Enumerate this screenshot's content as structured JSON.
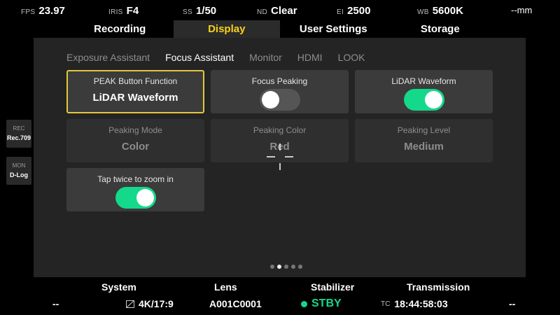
{
  "status_top": {
    "fps": {
      "key": "FPS",
      "value": "23.97"
    },
    "iris": {
      "key": "IRIS",
      "value": "F4"
    },
    "ss": {
      "key": "SS",
      "value": "1/50"
    },
    "nd": {
      "key": "ND",
      "value": "Clear"
    },
    "ei": {
      "key": "EI",
      "value": "2500"
    },
    "wb": {
      "key": "WB",
      "value": "5600K"
    },
    "focus_distance": "--mm"
  },
  "main_tabs": [
    "Recording",
    "Display",
    "User Settings",
    "Storage"
  ],
  "active_main_tab": "Display",
  "sub_tabs": [
    "Exposure Assistant",
    "Focus Assistant",
    "Monitor",
    "HDMI",
    "LOOK"
  ],
  "active_sub_tab": "Focus Assistant",
  "cards": {
    "peak_button": {
      "title": "PEAK Button Function",
      "value": "LiDAR Waveform"
    },
    "focus_peaking": {
      "title": "Focus Peaking",
      "state": "off"
    },
    "lidar_waveform": {
      "title": "LiDAR Waveform",
      "state": "on"
    },
    "peaking_mode": {
      "title": "Peaking Mode",
      "value": "Color"
    },
    "peaking_color": {
      "title": "Peaking Color",
      "value": "Red"
    },
    "peaking_level": {
      "title": "Peaking Level",
      "value": "Medium"
    },
    "tap_zoom": {
      "title": "Tap twice to zoom in",
      "state": "on"
    }
  },
  "pagination": {
    "current": 2,
    "total": 5
  },
  "side": {
    "rec": {
      "key": "REC",
      "value": "Rec.709"
    },
    "mon": {
      "key": "MON",
      "value": "D-Log"
    }
  },
  "bottom": {
    "system": {
      "header": "System",
      "value": "--"
    },
    "lens": {
      "header": "Lens",
      "format": "4K/17:9",
      "value": "A001C0001"
    },
    "stabilizer": {
      "header": "Stabilizer",
      "value": "STBY"
    },
    "transmission": {
      "header": "Transmission",
      "tc_key": "TC",
      "tc": "18:44:58:03"
    },
    "right_value": "--"
  },
  "colors": {
    "accent_yellow": "#f7d117",
    "toggle_on": "#14d98a",
    "panel_bg": "#242424",
    "card_bg": "#3b3b3b"
  }
}
